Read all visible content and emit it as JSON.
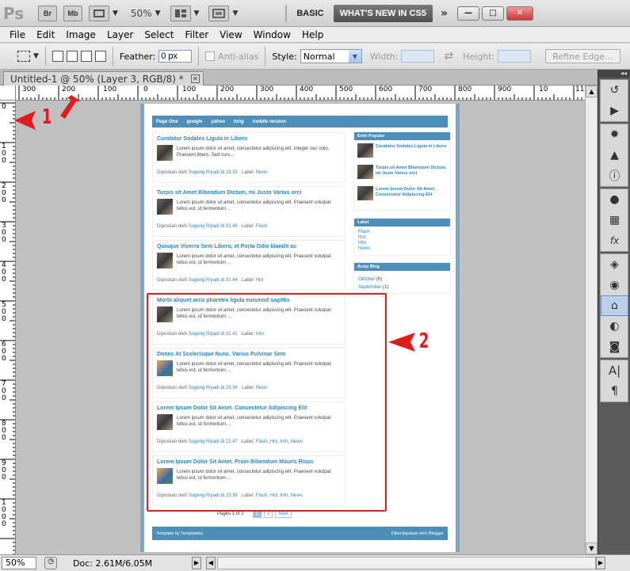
{
  "appbar": {
    "logo": "Ps",
    "bridge_label": "Br",
    "minibridge_label": "Mb",
    "zoom_level": "50%",
    "workspace_basic": "BASIC",
    "workspace_new": "WHAT'S NEW IN CS5",
    "more_glyph": "»",
    "min_glyph": "—",
    "max_glyph": "□",
    "close_glyph": "✕"
  },
  "menu": [
    "File",
    "Edit",
    "Image",
    "Layer",
    "Select",
    "Filter",
    "View",
    "Window",
    "Help"
  ],
  "options": {
    "feather_label": "Feather:",
    "feather_value": "0 px",
    "antialias_label": "Anti-alias",
    "style_label": "Style:",
    "style_value": "Normal",
    "width_label": "Width:",
    "height_label": "Height:",
    "swap_glyph": "⇄",
    "refine_label": "Refine Edge..."
  },
  "document": {
    "tab_title": "Untitled-1 @ 50% (Layer 3, RGB/8) *",
    "tab_close": "✕",
    "ruler_top": [
      "300",
      "200",
      "100",
      "0",
      "100",
      "200",
      "300",
      "400",
      "500",
      "600",
      "700",
      "800",
      "900",
      "10",
      "11"
    ],
    "ruler_left": [
      "0",
      "100",
      "200",
      "300",
      "400",
      "500",
      "600",
      "700",
      "800",
      "900",
      "1000"
    ]
  },
  "webpage": {
    "nav": [
      "Page One",
      "google",
      "yahoo",
      "bing",
      "mobile version"
    ],
    "posts": [
      {
        "title": "Curabitur Sodales Ligula in Libero",
        "excerpt": "Lorem ipsum dolor sit amet, consectetur adipiscing elit. Integer nec odio. Praesent libero. Sed curs...",
        "time": "23.33",
        "labels": "News"
      },
      {
        "title": "Turpis sit Amet Bibendum Dictum, mi Justo Varius orci",
        "excerpt": "Lorem ipsum dolor sit amet, consectetur adipiscing elit. Praesent volutpat tellus est, id fermentum ...",
        "time": "01.49",
        "labels": "Flash"
      },
      {
        "title": "Quisque Viverra Sem Libero, et Porta Odio blandit ac",
        "excerpt": "Lorem ipsum dolor sit amet, consectetur adipiscing elit. Praesent volutpat tellus est, id fermentum ...",
        "time": "01.44",
        "labels": "Hot"
      },
      {
        "title": "Morbi aliquet arcu pharetra ligula euismod sagittis",
        "excerpt": "Lorem ipsum dolor sit amet, consectetur adipiscing elit. Praesent volutpat tellus est, id fermentum ...",
        "time": "01.41",
        "labels": "Info"
      },
      {
        "title": "Donec At Scelerisque Nunc. Varius Pulvinar Sem",
        "excerpt": "Lorem ipsum dolor sit amet, consectetur adipiscing elit. Praesent volutpat tellus est, id fermentum ...",
        "time": "23.36",
        "labels": "News"
      },
      {
        "title": "Lorem Ipsum Dolor Sit Amet. Consectetur Adipiscing Elit",
        "excerpt": "Lorem ipsum dolor sit amet, consectetur adipiscing elit. Praesent volutpat tellus est, id fermentum ...",
        "time": "22.47",
        "labels": "Flash, Hot, Info, News"
      },
      {
        "title": "Lorem Ipsum Dolor Sit Amet. Proin Bibendum Mauris Risus",
        "excerpt": "Lorem ipsum dolor sit amet, consectetur adipiscing elit. Praesent volutpat tellus est, id fermentum ...",
        "time": "23.38",
        "labels": "Flash, Hot, Info, News"
      }
    ],
    "meta_prefix": "Diposkan oleh",
    "author": "Sugeng Riyadi",
    "at_word": "di",
    "label_word": "Label:",
    "widgets": {
      "popular_head": "Entri Populer",
      "popular": [
        "Curabitur Sodales Ligula in Libero",
        "Turpis sit Amet Bibendum Dictum, mi Justo Varius orci",
        "Lorem Ipsum Dolor Sit Amet, Consectetur Adipiscing Elit"
      ],
      "label_head": "Label",
      "labels": [
        "Flash",
        "Hot",
        "Info",
        "News"
      ],
      "archive_head": "Arsip Blog",
      "archive": [
        {
          "month": "Oktober",
          "count": "(6)"
        },
        {
          "month": "September",
          "count": "(1)"
        }
      ]
    },
    "pager": {
      "text": "Pages 1 of 2",
      "p1": "1",
      "p2": "2",
      "next": "Next"
    },
    "footer": {
      "left": "Template by Templateku",
      "right": "Diberdayakan oleh Blogger"
    }
  },
  "annotations": {
    "one": "1",
    "two": "2"
  },
  "status": {
    "zoom": "50%",
    "doc": "Doc: 2.61M/6.05M",
    "arrow": "▶",
    "left_arrow": "◀",
    "right_arrow": "▶"
  },
  "panel": {
    "collapse": "◂◂"
  },
  "colors": {
    "accent": "#4d8fb8",
    "link": "#2a86c0",
    "annotation": "#e41b1b"
  }
}
